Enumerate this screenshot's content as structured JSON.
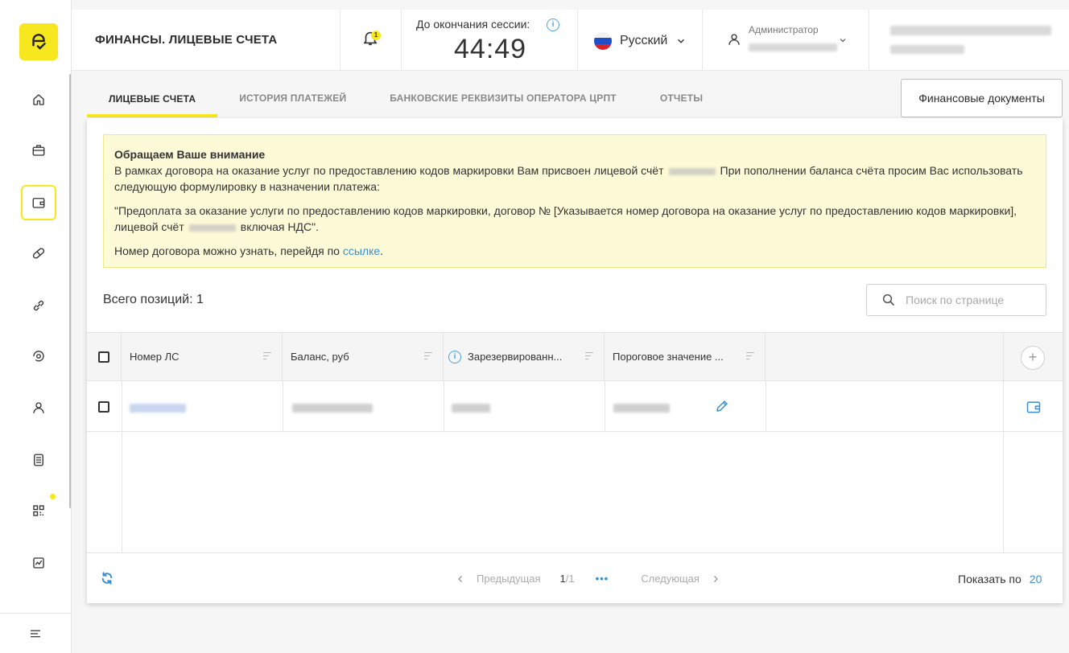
{
  "sidebar": {
    "logo_icon": "brand-logo-icon",
    "items": [
      {
        "icon": "home-icon"
      },
      {
        "icon": "briefcase-icon"
      },
      {
        "icon": "wallet-icon",
        "active": true
      },
      {
        "icon": "pill-icon"
      },
      {
        "icon": "link-icon"
      },
      {
        "icon": "target-icon"
      },
      {
        "icon": "user-icon"
      },
      {
        "icon": "document-list-icon"
      },
      {
        "icon": "qr-code-icon"
      },
      {
        "icon": "chart-icon"
      }
    ],
    "menu_icon": "hamburger-menu-icon"
  },
  "header": {
    "title": "ФИНАНСЫ. ЛИЦЕВЫЕ СЧЕТА",
    "notifications_count": "1",
    "session_label": "До окончания сессии:",
    "session_time": "44:49",
    "language": "Русский",
    "user_role": "Администратор"
  },
  "tabs": [
    {
      "label": "ЛИЦЕВЫЕ СЧЕТА",
      "active": true
    },
    {
      "label": "ИСТОРИЯ ПЛАТЕЖЕЙ"
    },
    {
      "label": "БАНКОВСКИЕ РЕКВИЗИТЫ ОПЕРАТОРА ЦРПТ"
    },
    {
      "label": "ОТЧЕТЫ"
    }
  ],
  "fin_docs_button": "Финансовые документы",
  "notice": {
    "title": "Обращаем Ваше внимание",
    "line1_a": "В рамках договора на оказание услуг по предоставлению кодов маркировки Вам присвоен лицевой счёт",
    "line1_b": "При пополнении баланса счёта просим Вас использовать следующую формулировку в назначении платежа:",
    "quote_a": "\"Предоплата за оказание услуги по предоставлению кодов маркировки, договор № [Указывается номер договора на оказание услуг по предоставлению кодов маркировки], лицевой счёт",
    "quote_b": "включая НДС\".",
    "contract_a": "Номер договора можно узнать, перейдя по",
    "contract_link": "ссылке",
    "contract_end": "."
  },
  "total": "Всего позиций: 1",
  "search": {
    "placeholder": "Поиск по странице"
  },
  "table": {
    "columns": [
      "Номер ЛС",
      "Баланс, руб",
      "Зарезервированн...",
      "Пороговое значение ..."
    ]
  },
  "pagination": {
    "prev": "Предыдущая",
    "page_current": "1",
    "page_total": "/1",
    "dots": "•••",
    "next": "Следующая",
    "per_page_label": "Показать по",
    "per_page_value": "20"
  },
  "colors": {
    "accent": "#f6e71e",
    "link": "#3a8fd1",
    "notice_bg": "#fdfbd7"
  }
}
